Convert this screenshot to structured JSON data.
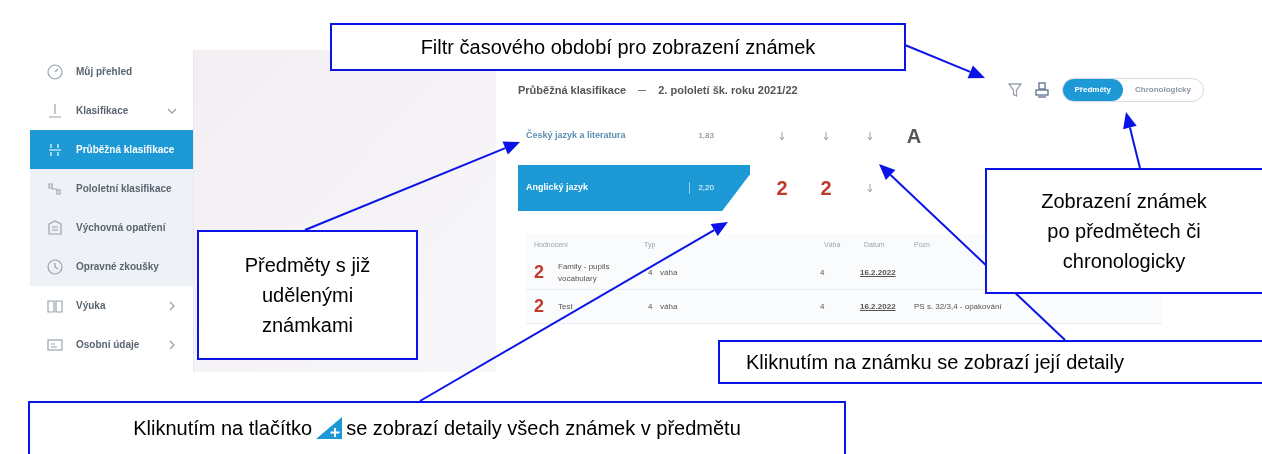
{
  "sidebar": {
    "items": [
      {
        "label": "Můj přehled",
        "selected": false
      },
      {
        "label": "Klasifikace",
        "selected": false,
        "expanded": true,
        "children": [
          {
            "label": "Průběžná klasifikace",
            "selected": true
          },
          {
            "label": "Pololetní klasifikace",
            "selected": false
          },
          {
            "label": "Výchovná opatření",
            "selected": false
          },
          {
            "label": "Opravné zkoušky",
            "selected": false
          }
        ]
      },
      {
        "label": "Výuka",
        "selected": false,
        "expanded": false
      },
      {
        "label": "Osobní údaje",
        "selected": false,
        "expanded": false
      }
    ]
  },
  "header": {
    "title": "Průběžná klasifikace",
    "period": "2. pololetí šk. roku 2021/22"
  },
  "view_toggle": [
    {
      "label": "Předměty",
      "selected": true
    },
    {
      "label": "Chronologicky",
      "selected": false
    }
  ],
  "subjects": [
    {
      "name": "Český jazyk a literatura",
      "average": "1,83",
      "selected": false,
      "grades": [
        {
          "kind": "small"
        },
        {
          "kind": "small"
        },
        {
          "kind": "small"
        },
        {
          "kind": "big",
          "value": "A"
        }
      ]
    },
    {
      "name": "Anglický jazyk",
      "average": "2,20",
      "selected": true,
      "grades": [
        {
          "kind": "big",
          "value": "2"
        },
        {
          "kind": "big",
          "value": "2"
        },
        {
          "kind": "small"
        }
      ]
    }
  ],
  "detail_table": {
    "columns": [
      "Hodnocení",
      "Typ",
      "Váha",
      "Datum",
      "Pozn"
    ],
    "rows": [
      {
        "grade": "2",
        "topic": "Family - pupils vocabulary",
        "weight": "4",
        "type": "váha",
        "count": "4",
        "date": "16.2.2022",
        "note": ""
      },
      {
        "grade": "2",
        "topic": "Test",
        "weight": "4",
        "type": "váha",
        "count": "4",
        "date": "16.2.2022",
        "note": "PS s. 32/3,4 - opakování"
      }
    ]
  },
  "callouts": [
    {
      "kind": "filter",
      "text": "Filtr časového období pro zobrazení známek"
    },
    {
      "kind": "toggle",
      "lines": [
        "Zobrazení známek",
        "po předmětech či",
        "chronologicky"
      ]
    },
    {
      "kind": "subjects",
      "lines": [
        "Předměty s již",
        "udělenými",
        "známkami"
      ]
    },
    {
      "kind": "grade",
      "text": "Kliknutím na známku se zobrazí její detaily"
    },
    {
      "kind": "expand",
      "before": "Kliknutím na tlačítko",
      "after": "se zobrazí detaily všech známek v předmětu"
    }
  ]
}
